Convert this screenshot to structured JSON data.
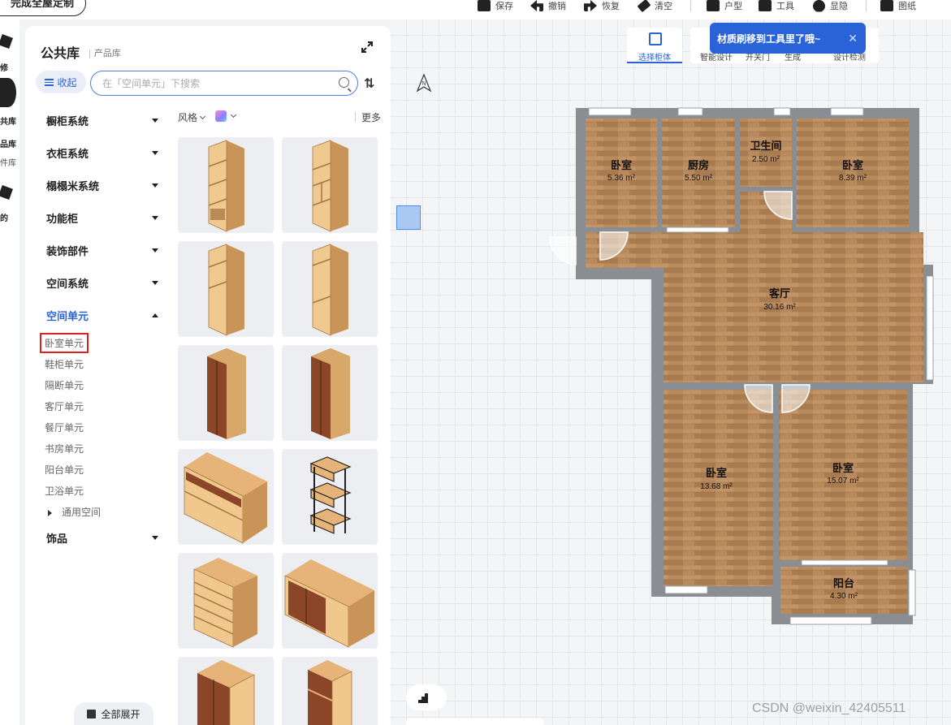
{
  "toolbar": {
    "finish_label": "完成全屋定制",
    "items": [
      {
        "label": "保存",
        "icon": "save-icon"
      },
      {
        "label": "撤销",
        "icon": "undo-icon"
      },
      {
        "label": "恢复",
        "icon": "redo-icon"
      },
      {
        "label": "清空",
        "icon": "eraser-icon"
      },
      {
        "label": "户型",
        "icon": "floorplan-icon"
      },
      {
        "label": "工具",
        "icon": "paint-roller-icon"
      },
      {
        "label": "显隐",
        "icon": "eye-icon"
      },
      {
        "label": "图纸",
        "icon": "drawing-icon"
      }
    ]
  },
  "rail": {
    "items": [
      {
        "label": "修",
        "icon": "cube-icon"
      },
      {
        "label": "共库",
        "icon": "public-library-icon"
      },
      {
        "label": "品库",
        "icon": ""
      },
      {
        "label": "件库",
        "icon": ""
      },
      {
        "label": "的",
        "icon": "my-icon"
      }
    ]
  },
  "library": {
    "title": "公共库",
    "subtitle": "产品库",
    "collapse_label": "收起",
    "search_placeholder": "在「空间单元」下搜索",
    "categories": [
      {
        "label": "橱柜系统"
      },
      {
        "label": "衣柜系统"
      },
      {
        "label": "榻榻米系统"
      },
      {
        "label": "功能柜"
      },
      {
        "label": "装饰部件"
      },
      {
        "label": "空间系统"
      },
      {
        "label": "空间单元"
      },
      {
        "label": "饰品"
      }
    ],
    "subcategories": [
      {
        "label": "卧室单元"
      },
      {
        "label": "鞋柜单元"
      },
      {
        "label": "隔断单元"
      },
      {
        "label": "客厅单元"
      },
      {
        "label": "餐厅单元"
      },
      {
        "label": "书房单元"
      },
      {
        "label": "阳台单元"
      },
      {
        "label": "卫浴单元"
      }
    ],
    "general_space_label": "通用空间",
    "expand_all_label": "全部展开",
    "filters": {
      "style_label": "风格",
      "more_label": "更多"
    }
  },
  "canvas": {
    "tools": [
      {
        "label": "选择柜体"
      },
      {
        "label": "智能设计"
      },
      {
        "label": "开关门"
      },
      {
        "label": "生成"
      },
      {
        "label": "设计检测"
      }
    ],
    "tooltip": "材质刷移到工具里了哦~",
    "compass_label": "N",
    "rooms": [
      {
        "name": "卧室",
        "area": "5.36 m²"
      },
      {
        "name": "厨房",
        "area": "5.50 m²"
      },
      {
        "name": "卫生间",
        "area": "2.50 m²"
      },
      {
        "name": "卧室",
        "area": "8.39 m²"
      },
      {
        "name": "客厅",
        "area": "30.16 m²"
      },
      {
        "name": "卧室",
        "area": "13.68 m²"
      },
      {
        "name": "卧室",
        "area": "15.07 m²"
      },
      {
        "name": "阳台",
        "area": "4.30 m²"
      }
    ]
  },
  "watermark": "CSDN @weixin_42405511",
  "colors": {
    "accent": "#2a63d8",
    "wall": "#8a8d92",
    "floor": "#b98a5c",
    "highlight": "#e02020"
  }
}
